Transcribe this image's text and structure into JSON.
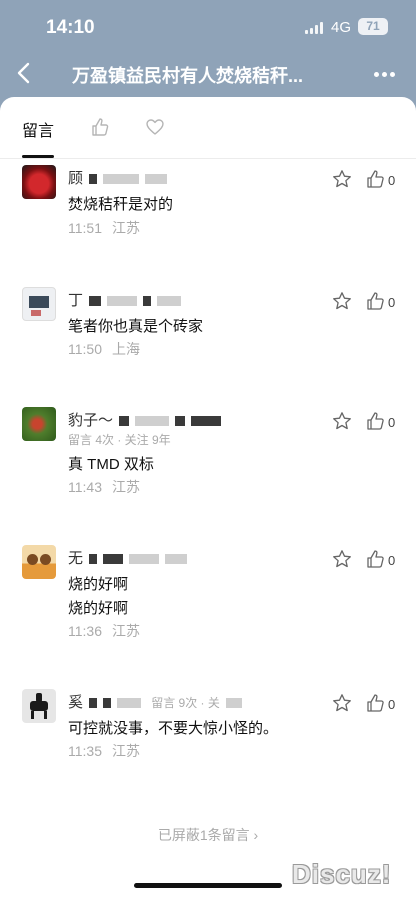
{
  "status": {
    "time": "14:10",
    "network": "4G",
    "battery": "71"
  },
  "nav": {
    "title": "万盈镇益民村有人焚烧秸秆..."
  },
  "tabs": {
    "comments": "留言"
  },
  "comments": [
    {
      "name": "顾",
      "meta": "",
      "text1": "焚烧秸秆是对的",
      "text2": "",
      "time": "11:51",
      "location": "江苏",
      "likes": "0"
    },
    {
      "name": "丁",
      "meta": "",
      "text1": "笔者你也真是个砖家",
      "text2": "",
      "time": "11:50",
      "location": "上海",
      "likes": "0"
    },
    {
      "name": "豹子～",
      "meta": "留言 4次 · 关注 9年",
      "text1": "真 TMD 双标",
      "text2": "",
      "time": "11:43",
      "location": "江苏",
      "likes": "0"
    },
    {
      "name": "无",
      "meta": "",
      "text1": "烧的好啊",
      "text2": "烧的好啊",
      "time": "11:36",
      "location": "江苏",
      "likes": "0"
    },
    {
      "name": "奚",
      "meta": "留言 9次 · 关",
      "text1": "可控就没事，不要大惊小怪的。",
      "text2": "",
      "time": "11:35",
      "location": "江苏",
      "likes": "0"
    }
  ],
  "footer": {
    "hidden_comments": "已屏蔽1条留言 ›"
  },
  "watermark": "Discuz!",
  "colors": {
    "header_bg": "#8fa3b8",
    "sheet_bg": "#ffffff",
    "meta_text": "#aaaaaa"
  }
}
